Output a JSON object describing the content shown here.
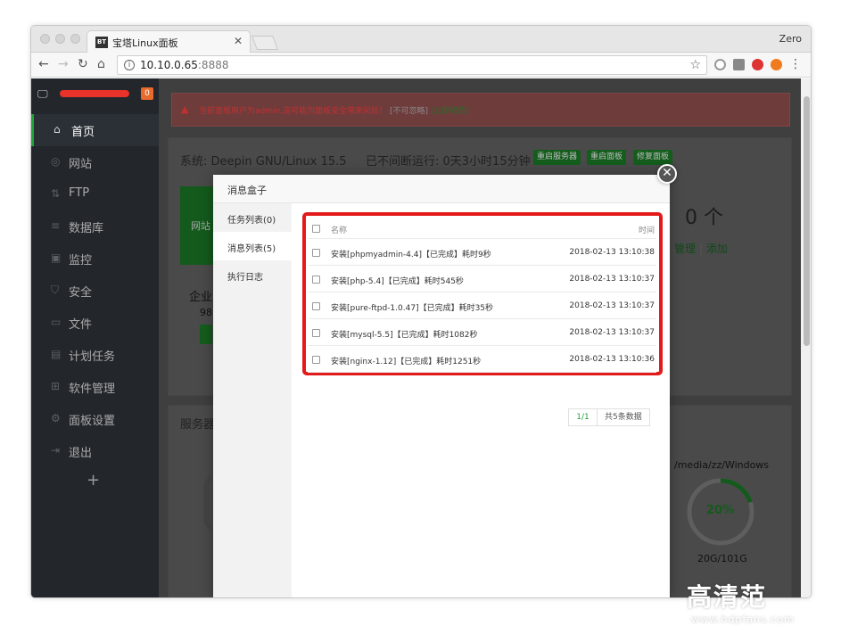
{
  "browser": {
    "tab_title": "宝塔Linux面板",
    "tab_favicon": "BT",
    "profile": "Zero",
    "url_host": "10.10.0.65",
    "url_port": ":8888"
  },
  "sidebar": {
    "badge": "0",
    "items": [
      {
        "label": "首页",
        "icon": "home-icon"
      },
      {
        "label": "网站",
        "icon": "globe-icon"
      },
      {
        "label": "FTP",
        "icon": "ftp-icon"
      },
      {
        "label": "数据库",
        "icon": "database-icon"
      },
      {
        "label": "监控",
        "icon": "monitor-icon"
      },
      {
        "label": "安全",
        "icon": "shield-icon"
      },
      {
        "label": "文件",
        "icon": "folder-icon"
      },
      {
        "label": "计划任务",
        "icon": "calendar-icon"
      },
      {
        "label": "软件管理",
        "icon": "grid-icon"
      },
      {
        "label": "面板设置",
        "icon": "gear-icon"
      },
      {
        "label": "退出",
        "icon": "logout-icon"
      }
    ],
    "add": "+"
  },
  "warning": {
    "text": "当前面板用户为admin,这可能为面板安全带来风险！",
    "ignore": "[不可忽略]",
    "fix": "[立即修改]"
  },
  "system": {
    "os": "系统: Deepin GNU/Linux 15.5",
    "uptime": "已不间断运行: 0天3小时15分钟",
    "buttons": [
      "重启服务器",
      "重启面板",
      "修复面板"
    ]
  },
  "background": {
    "site_label": "网站",
    "count": "0 个",
    "manage": "管理",
    "add": "添加",
    "enterprise": "企业",
    "enterprise_num": "98",
    "server_title": "服务器",
    "disk_name": "/media/zz/Windows",
    "disk_percent": "20%",
    "disk_percent_value": 20,
    "disk_size": "20G/101G",
    "left_mount": "/m"
  },
  "modal": {
    "title": "消息盒子",
    "tabs": [
      "任务列表(0)",
      "消息列表(5)",
      "执行日志"
    ],
    "active_tab": 1,
    "columns": {
      "name": "名称",
      "time": "时间"
    },
    "rows": [
      {
        "name": "安装[phpmyadmin-4.4]【已完成】耗时9秒",
        "time": "2018-02-13 13:10:38"
      },
      {
        "name": "安装[php-5.4]【已完成】耗时545秒",
        "time": "2018-02-13 13:10:37"
      },
      {
        "name": "安装[pure-ftpd-1.0.47]【已完成】耗时35秒",
        "time": "2018-02-13 13:10:37"
      },
      {
        "name": "安装[mysql-5.5]【已完成】耗时1082秒",
        "time": "2018-02-13 13:10:37"
      },
      {
        "name": "安装[nginx-1.12]【已完成】耗时1251秒",
        "time": "2018-02-13 13:10:36"
      }
    ],
    "pager": {
      "current": "1/1",
      "total": "共5条数据"
    }
  },
  "watermark": {
    "title": "高清范",
    "url": "www.hdpfans.com"
  },
  "colors": {
    "brand_green": "#20a53a",
    "highlight_red": "#e31a1a",
    "sidebar_bg": "#23272c"
  }
}
